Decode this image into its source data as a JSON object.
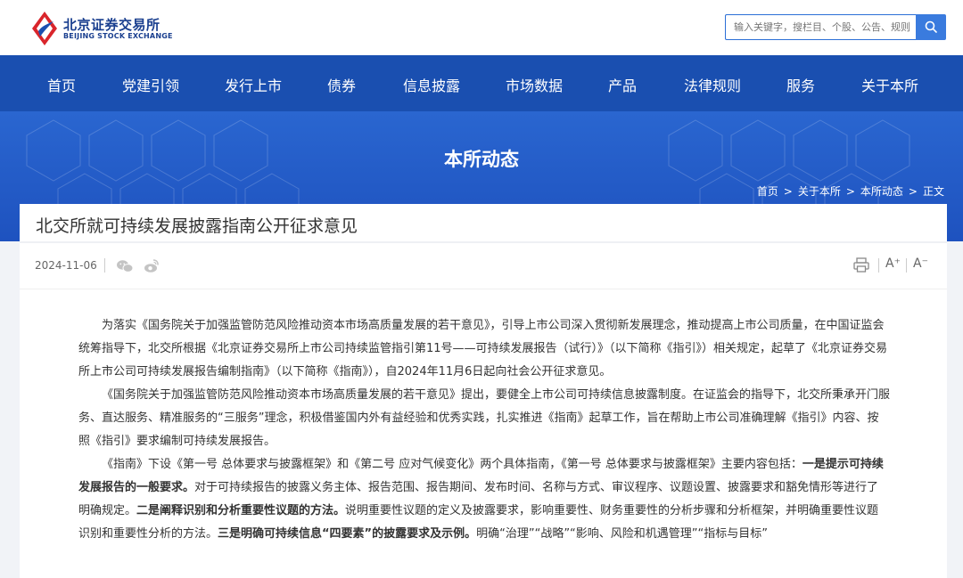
{
  "header": {
    "logo_cn": "北京证券交易所",
    "logo_en": "BEIJING STOCK EXCHANGE",
    "search_placeholder": "输入关键字，搜栏目、个股、公告、规则",
    "search_icon": "search-icon"
  },
  "nav": {
    "items": [
      "首页",
      "党建引领",
      "发行上市",
      "债券",
      "信息披露",
      "市场数据",
      "产品",
      "法律规则",
      "服务",
      "关于本所"
    ]
  },
  "banner": {
    "title": "本所动态",
    "breadcrumb": [
      "首页",
      "关于本所",
      "本所动态",
      "正文"
    ],
    "breadcrumb_sep": ">"
  },
  "article": {
    "title": "北交所就可持续发展披露指南公开征求意见",
    "date": "2024-11-06",
    "share_icons": [
      "wechat-icon",
      "weibo-icon"
    ],
    "tools": {
      "print_icon": "print-icon",
      "font_increase": "A⁺",
      "font_decrease": "A⁻"
    },
    "paragraphs": [
      [
        {
          "t": "为落实《国务院关于加强监管防范风险推动资本市场高质量发展的若干意见》，引导上市公司深入贯彻新发展理念，推动提高上市公司质量，在中国证监会统筹指导下，北交所根据《北京证券交易所上市公司持续监管指引第11号——可持续发展报告（试行）》（以下简称《指引》）相关规定，起草了《北京证券交易所上市公司可持续发展报告编制指南》（以下简称《指南》），自2024年11月6日起向社会公开征求意见。",
          "b": false
        }
      ],
      [
        {
          "t": "《国务院关于加强监管防范风险推动资本市场高质量发展的若干意见》提出，要健全上市公司可持续信息披露制度。在证监会的指导下，北交所秉承开门服务、直达服务、精准服务的“三服务”理念，积极借鉴国内外有益经验和优秀实践，扎实推进《指南》起草工作，旨在帮助上市公司准确理解《指引》内容、按照《指引》要求编制可持续发展报告。",
          "b": false
        }
      ],
      [
        {
          "t": "《指南》下设《第一号 总体要求与披露框架》和《第二号 应对气候变化》两个具体指南，《第一号 总体要求与披露框架》主要内容包括：",
          "b": false
        },
        {
          "t": "一是提示可持续发展报告的一般要求。",
          "b": true
        },
        {
          "t": "对于可持续报告的披露义务主体、报告范围、报告期间、发布时间、名称与方式、审议程序、议题设置、披露要求和豁免情形等进行了明确规定。",
          "b": false
        },
        {
          "t": "二是阐释识别和分析重要性议题的方法。",
          "b": true
        },
        {
          "t": "说明重要性议题的定义及披露要求，影响重要性、财务重要性的分析步骤和分析框架，并明确重要性议题识别和重要性分析的方法。",
          "b": false
        },
        {
          "t": "三是明确可持续信息“四要素”的披露要求及示例。",
          "b": true
        },
        {
          "t": "明确“治理”“战略”“影响、风险和机遇管理”“指标与目标”",
          "b": false
        }
      ]
    ]
  },
  "colors": {
    "nav_bg": "#1a4fb0",
    "banner_bg": "#2a66d0",
    "accent": "#3a7bde",
    "logo_red": "#d9252b"
  }
}
